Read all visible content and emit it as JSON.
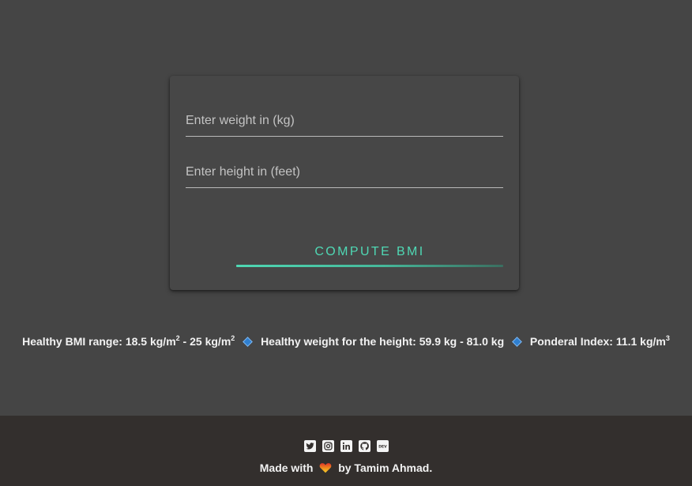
{
  "form": {
    "weight_placeholder": "Enter weight in (kg)",
    "weight_value": "",
    "height_placeholder": "Enter height in (feet)",
    "height_value": "",
    "compute_label": "COMPUTE BMI"
  },
  "info": {
    "bmi_range_label": "Healthy BMI range: ",
    "bmi_range_low": "18.5 kg/m",
    "bmi_range_sep": " - ",
    "bmi_range_high": "25 kg/m",
    "bmi_exp": "2",
    "healthy_weight": "Healthy weight for the height: 59.9 kg - 81.0 kg",
    "ponderal_label": "Ponderal Index: 11.1 kg/m",
    "ponderal_exp": "3"
  },
  "footer": {
    "icons": [
      "twitter-icon",
      "instagram-icon",
      "linkedin-icon",
      "github-icon",
      "dev-icon"
    ],
    "made_with_prefix": "Made with",
    "made_with_suffix": "by Tamim Ahmad."
  },
  "colors": {
    "page_bg": "#454545",
    "card_bg": "#474747",
    "accent": "#4fd8b4",
    "footer_bg": "#332f2d",
    "diamond": "#2f7fd0"
  }
}
